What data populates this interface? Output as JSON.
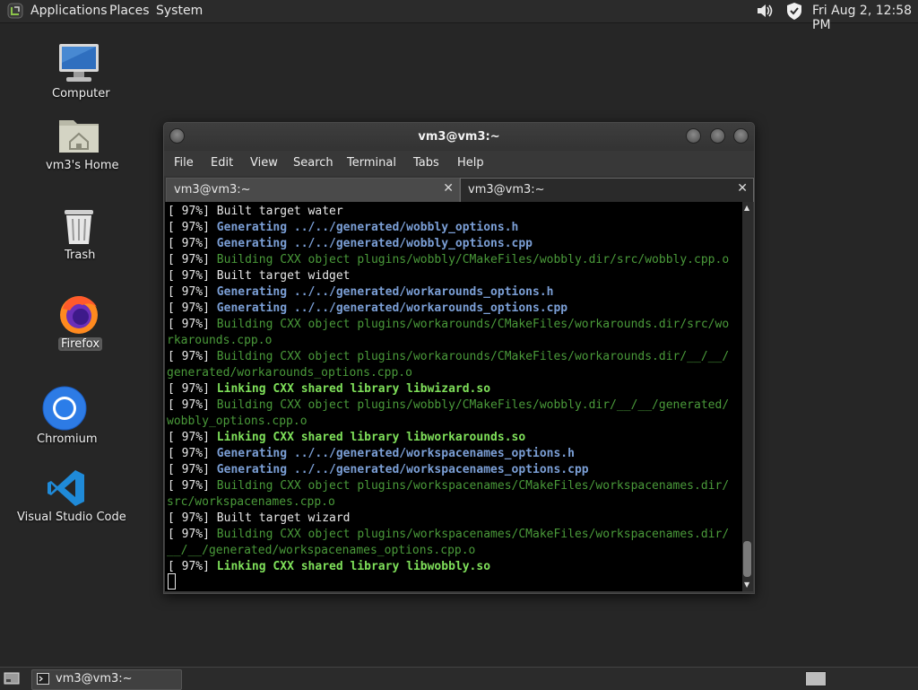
{
  "top_panel": {
    "menus": [
      "Applications",
      "Places",
      "System"
    ],
    "clock": "Fri Aug  2, 12:58 PM",
    "icons": [
      "mate-menu-icon",
      "sound-icon",
      "shield-update-icon"
    ]
  },
  "desktop": {
    "icons": [
      {
        "label": "Computer",
        "icon": "computer-icon"
      },
      {
        "label": "vm3's Home",
        "icon": "home-folder-icon"
      },
      {
        "label": "Trash",
        "icon": "trash-icon"
      },
      {
        "label": "Firefox",
        "icon": "firefox-icon",
        "selected": true
      },
      {
        "label": "Chromium",
        "icon": "chromium-icon"
      },
      {
        "label": "Visual Studio Code",
        "icon": "vscode-icon"
      }
    ]
  },
  "window": {
    "title": "vm3@vm3:~",
    "menu": [
      "File",
      "Edit",
      "View",
      "Search",
      "Terminal",
      "Tabs",
      "Help"
    ],
    "tabs": [
      {
        "label": "vm3@vm3:~",
        "active": false
      },
      {
        "label": "vm3@vm3:~",
        "active": true
      }
    ],
    "terminal": {
      "lines": [
        {
          "prefix": "[ 97%] ",
          "text": "Built target water",
          "style": "plain"
        },
        {
          "prefix": "[ 97%] ",
          "text": "Generating ../../generated/wobbly_options.h",
          "style": "blue"
        },
        {
          "prefix": "[ 97%] ",
          "text": "Generating ../../generated/wobbly_options.cpp",
          "style": "blue"
        },
        {
          "prefix": "[ 97%] ",
          "text": "Building CXX object plugins/wobbly/CMakeFiles/wobbly.dir/src/wobbly.cpp.o",
          "style": "green"
        },
        {
          "prefix": "[ 97%] ",
          "text": "Built target widget",
          "style": "plain"
        },
        {
          "prefix": "[ 97%] ",
          "text": "Generating ../../generated/workarounds_options.h",
          "style": "blue"
        },
        {
          "prefix": "[ 97%] ",
          "text": "Generating ../../generated/workarounds_options.cpp",
          "style": "blue"
        },
        {
          "prefix": "[ 97%] ",
          "text": "Building CXX object plugins/workarounds/CMakeFiles/workarounds.dir/src/wo",
          "style": "green"
        },
        {
          "prefix": "",
          "text": "rkarounds.cpp.o",
          "style": "green"
        },
        {
          "prefix": "[ 97%] ",
          "text": "Building CXX object plugins/workarounds/CMakeFiles/workarounds.dir/__/__/",
          "style": "green"
        },
        {
          "prefix": "",
          "text": "generated/workarounds_options.cpp.o",
          "style": "green"
        },
        {
          "prefix": "[ 97%] ",
          "text": "Linking CXX shared library libwizard.so",
          "style": "bold"
        },
        {
          "prefix": "[ 97%] ",
          "text": "Building CXX object plugins/wobbly/CMakeFiles/wobbly.dir/__/__/generated/",
          "style": "green"
        },
        {
          "prefix": "",
          "text": "wobbly_options.cpp.o",
          "style": "green"
        },
        {
          "prefix": "[ 97%] ",
          "text": "Linking CXX shared library libworkarounds.so",
          "style": "bold"
        },
        {
          "prefix": "[ 97%] ",
          "text": "Generating ../../generated/workspacenames_options.h",
          "style": "blue"
        },
        {
          "prefix": "[ 97%] ",
          "text": "Generating ../../generated/workspacenames_options.cpp",
          "style": "blue"
        },
        {
          "prefix": "[ 97%] ",
          "text": "Building CXX object plugins/workspacenames/CMakeFiles/workspacenames.dir/",
          "style": "green"
        },
        {
          "prefix": "",
          "text": "src/workspacenames.cpp.o",
          "style": "green"
        },
        {
          "prefix": "[ 97%] ",
          "text": "Built target wizard",
          "style": "plain"
        },
        {
          "prefix": "[ 97%] ",
          "text": "Building CXX object plugins/workspacenames/CMakeFiles/workspacenames.dir/",
          "style": "green"
        },
        {
          "prefix": "",
          "text": "__/__/generated/workspacenames_options.cpp.o",
          "style": "green"
        },
        {
          "prefix": "[ 97%] ",
          "text": "Linking CXX shared library libwobbly.so",
          "style": "bold"
        }
      ]
    }
  },
  "taskbar": {
    "task_label": "vm3@vm3:~"
  },
  "colors": {
    "desktop_bg": "#262626",
    "term_bg": "#000000",
    "blue_text": "#7b9fd6",
    "green_text": "#4a9a3a",
    "bold_green_text": "#7fe05a"
  }
}
